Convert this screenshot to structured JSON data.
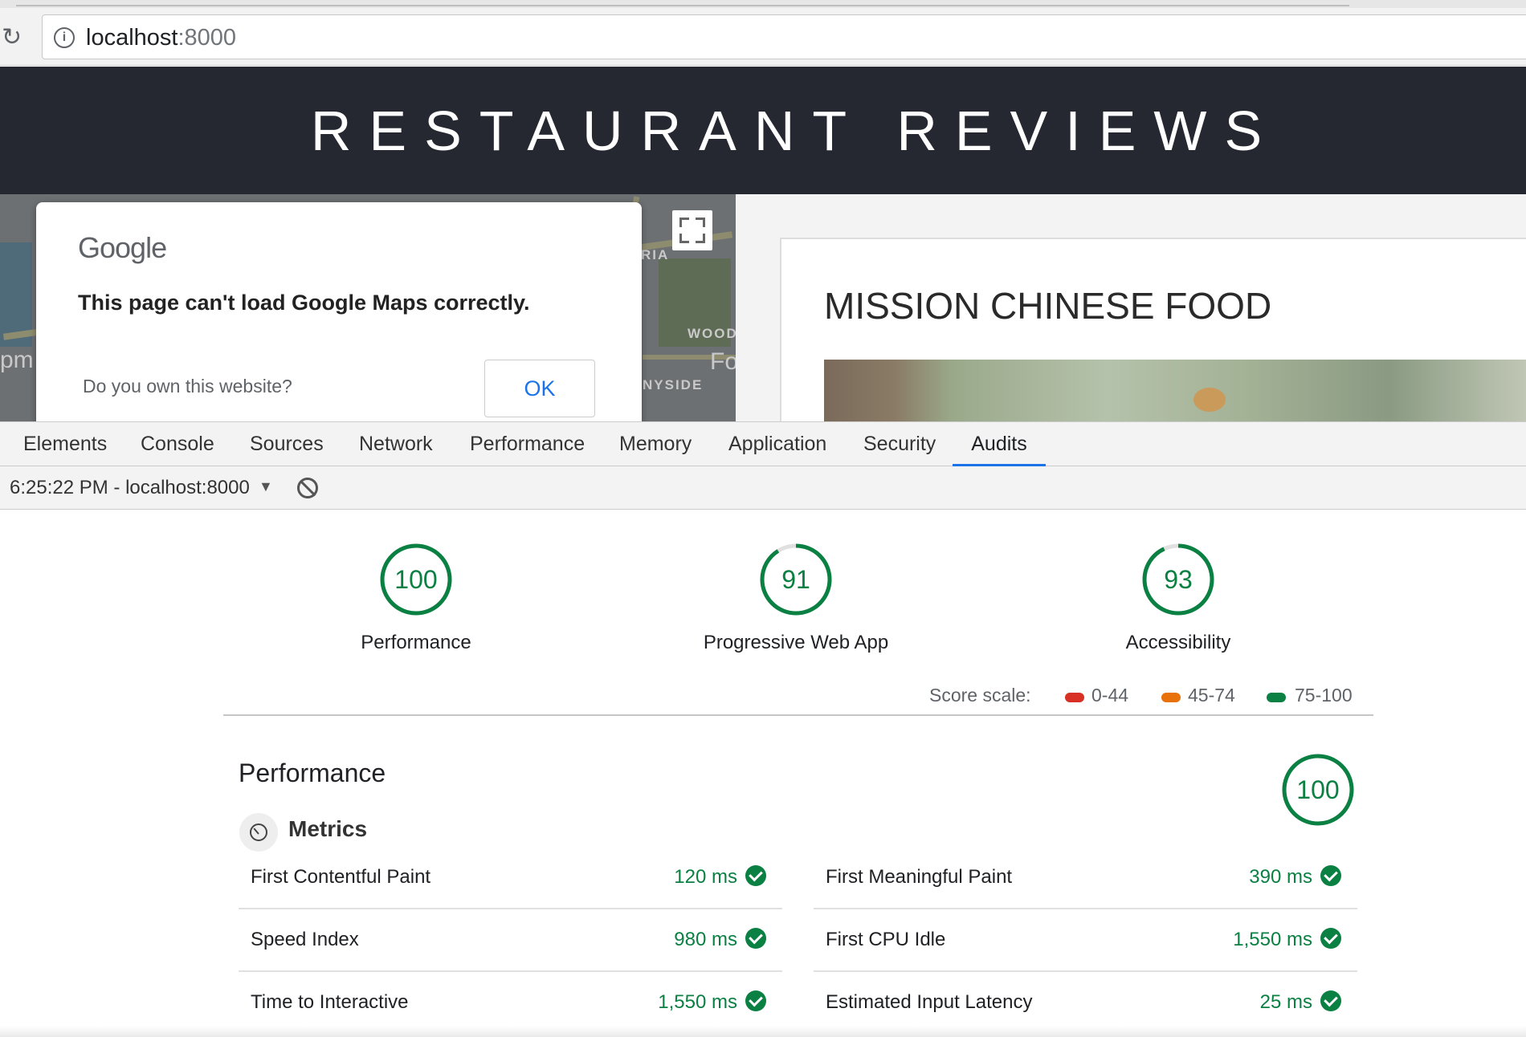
{
  "browser": {
    "url_host": "localhost",
    "url_port": ":8000"
  },
  "site": {
    "title": "RESTAURANT REVIEWS"
  },
  "map": {
    "labels": [
      "RIA",
      "WOOD",
      "Fo",
      "NYSIDE",
      "pm"
    ],
    "dialog": {
      "logo": "Google",
      "message": "This page can't load Google Maps correctly.",
      "own_question": "Do you own this website?",
      "ok_label": "OK"
    }
  },
  "restaurant": {
    "name": "MISSION CHINESE FOOD"
  },
  "devtools": {
    "tabs": [
      "Elements",
      "Console",
      "Sources",
      "Network",
      "Performance",
      "Memory",
      "Application",
      "Security",
      "Audits"
    ],
    "active_tab": "Audits",
    "run_label": "6:25:22 PM - localhost:8000"
  },
  "report": {
    "gauges": [
      {
        "score": "100",
        "label": "Performance"
      },
      {
        "score": "91",
        "label": "Progressive Web App"
      },
      {
        "score": "93",
        "label": "Accessibility"
      }
    ],
    "score_scale": {
      "label": "Score scale:",
      "ranges": [
        {
          "text": "0-44",
          "color": "#d93025"
        },
        {
          "text": "45-74",
          "color": "#e8710a"
        },
        {
          "text": "75-100",
          "color": "#0b8043"
        }
      ]
    },
    "section_title": "Performance",
    "section_score": "100",
    "metrics_title": "Metrics",
    "metrics": [
      {
        "name": "First Contentful Paint",
        "value": "120 ms"
      },
      {
        "name": "First Meaningful Paint",
        "value": "390 ms"
      },
      {
        "name": "Speed Index",
        "value": "980 ms"
      },
      {
        "name": "First CPU Idle",
        "value": "1,550 ms"
      },
      {
        "name": "Time to Interactive",
        "value": "1,550 ms"
      },
      {
        "name": "Estimated Input Latency",
        "value": "25 ms"
      }
    ]
  },
  "colors": {
    "pass_green": "#0b8043",
    "header_dark": "#252831",
    "link_blue": "#1a73e8"
  }
}
